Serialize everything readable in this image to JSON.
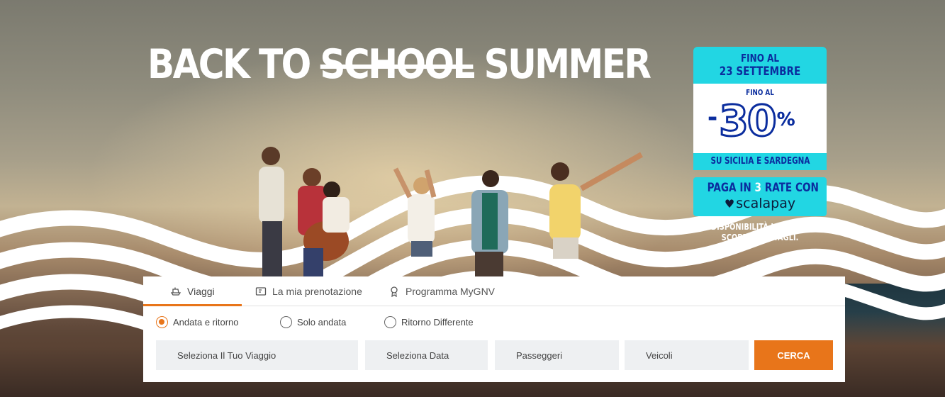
{
  "hero": {
    "headline_before": "BACK TO",
    "headline_strike": "SCHOOL",
    "headline_after": "SUMMER"
  },
  "promo": {
    "fino_al": "FINO AL",
    "date": "23 SETTEMBRE",
    "fino_al_small": "FINO AL",
    "discount_dash": "-",
    "discount_value": "30",
    "discount_symbol": "%",
    "destinations": "SU SICILIA E SARDEGNA",
    "pay_prefix": "PAGA IN",
    "pay_number": "3",
    "pay_suffix": "RATE CON",
    "pay_brand": "scalapay",
    "availability_line1": "DISPONIBILITÀ LIMITATA.",
    "availability_line2": "SCOPRI I DETTAGLI."
  },
  "widget": {
    "tabs": [
      {
        "label": "Viaggi",
        "icon": "ship-icon",
        "active": true
      },
      {
        "label": "La mia prenotazione",
        "icon": "ticket-icon",
        "active": false
      },
      {
        "label": "Programma MyGNV",
        "icon": "award-icon",
        "active": false
      }
    ],
    "trip_types": [
      {
        "label": "Andata e ritorno",
        "selected": true
      },
      {
        "label": "Solo andata",
        "selected": false
      },
      {
        "label": "Ritorno Differente",
        "selected": false
      }
    ],
    "fields": {
      "trip": "Seleziona Il Tuo Viaggio",
      "date": "Seleziona Data",
      "passengers": "Passeggeri",
      "vehicles": "Veicoli"
    },
    "search_label": "CERCA"
  },
  "colors": {
    "accent": "#e8751a",
    "promo_cyan": "#22d6e3",
    "promo_blue": "#0b2d9e"
  }
}
